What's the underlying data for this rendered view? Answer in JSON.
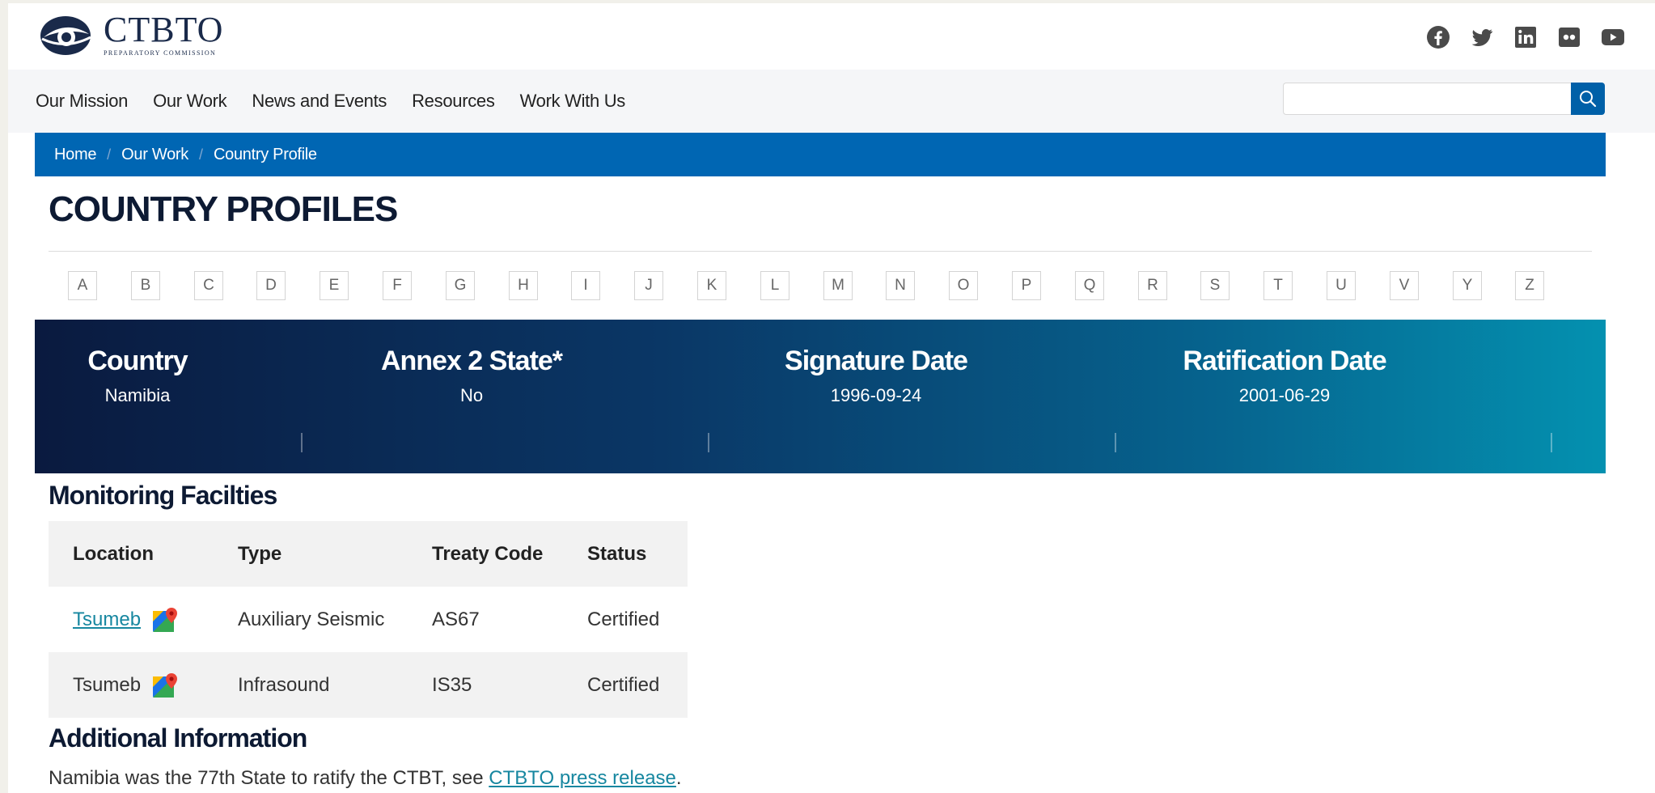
{
  "brand": {
    "name": "CTBTO",
    "subtitle": "PREPARATORY COMMISSION",
    "colors": {
      "navy": "#1a2a4a",
      "primary": "#0066b3",
      "link": "#1787a0"
    }
  },
  "social": [
    "facebook-icon",
    "twitter-icon",
    "linkedin-icon",
    "flickr-icon",
    "youtube-icon"
  ],
  "nav": {
    "items": [
      "Our Mission",
      "Our Work",
      "News and Events",
      "Resources",
      "Work With Us"
    ],
    "search_value": ""
  },
  "breadcrumb": [
    "Home",
    "Our Work",
    "Country Profile"
  ],
  "page_title": "COUNTRY PROFILES",
  "alphabet": [
    "A",
    "B",
    "C",
    "D",
    "E",
    "F",
    "G",
    "H",
    "I",
    "J",
    "K",
    "L",
    "M",
    "N",
    "O",
    "P",
    "Q",
    "R",
    "S",
    "T",
    "U",
    "V",
    "Y",
    "Z"
  ],
  "country": {
    "country_label": "Country",
    "country_value": "Namibia",
    "annex_label": "Annex 2 State*",
    "annex_value": "No",
    "signature_label": "Signature Date",
    "signature_value": "1996-09-24",
    "ratification_label": "Ratification Date",
    "ratification_value": "2001-06-29"
  },
  "monitoring": {
    "title": "Monitoring Facilties",
    "headers": [
      "Location",
      "Type",
      "Treaty Code",
      "Status"
    ],
    "rows": [
      {
        "location": "Tsumeb",
        "type": "Auxiliary Seismic",
        "code": "AS67",
        "status": "Certified"
      },
      {
        "location": "Tsumeb",
        "type": "Infrasound",
        "code": "IS35",
        "status": "Certified"
      }
    ]
  },
  "additional": {
    "title": "Additional Information",
    "text": "Namibia was the 77th State to ratify the CTBT, see ",
    "link": "CTBTO press release",
    "tail": "."
  }
}
